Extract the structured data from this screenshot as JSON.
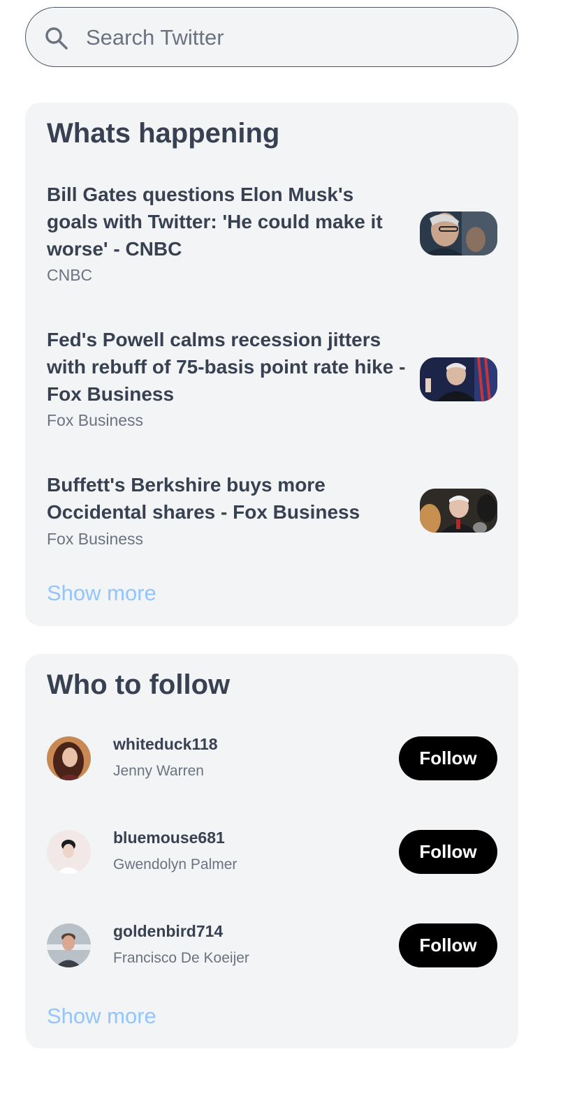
{
  "search": {
    "placeholder": "Search Twitter",
    "icon": "search-icon"
  },
  "happening": {
    "title": "Whats happening",
    "items": [
      {
        "headline": "Bill Gates questions Elon Musk's goals with Twitter: 'He could make it worse' - CNBC",
        "source": "CNBC",
        "thumbnail": "photo of man in glasses"
      },
      {
        "headline": "Fed's Powell calms recession jitters with rebuff of 75-basis point rate hike - Fox Business",
        "source": "Fox Business",
        "thumbnail": "photo of man at podium with flag"
      },
      {
        "headline": "Buffett's Berkshire buys more Occidental shares - Fox Business",
        "source": "Fox Business",
        "thumbnail": "photo of man in crowd"
      }
    ],
    "show_more": "Show more"
  },
  "who_to_follow": {
    "title": "Who to follow",
    "users": [
      {
        "handle": "whiteduck118",
        "name": "Jenny Warren",
        "follow_label": "Follow"
      },
      {
        "handle": "bluemouse681",
        "name": "Gwendolyn Palmer",
        "follow_label": "Follow"
      },
      {
        "handle": "goldenbird714",
        "name": "Francisco De Koeijer",
        "follow_label": "Follow"
      }
    ],
    "show_more": "Show more"
  },
  "colors": {
    "card_bg": "#f3f4f6",
    "text": "#374151",
    "muted": "#6b7280",
    "link": "#93c5fd",
    "button_bg": "#000000",
    "button_text": "#ffffff"
  }
}
